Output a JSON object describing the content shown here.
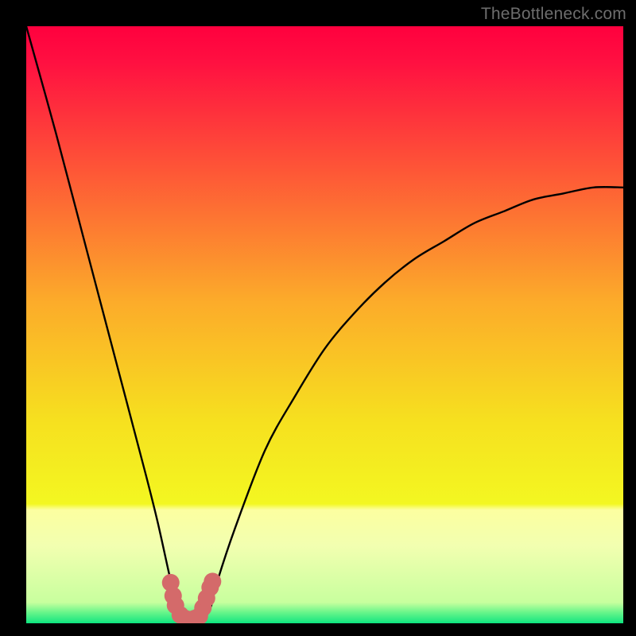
{
  "watermark": "TheBottleneck.com",
  "chart_data": {
    "type": "line",
    "title": "",
    "xlabel": "",
    "ylabel": "",
    "x_range": [
      0,
      100
    ],
    "y_range": [
      0,
      100
    ],
    "series": [
      {
        "name": "curve",
        "x": [
          0,
          5,
          10,
          15,
          20,
          22,
          24,
          25,
          26,
          27,
          28,
          29,
          30,
          31,
          32,
          35,
          40,
          45,
          50,
          55,
          60,
          65,
          70,
          75,
          80,
          85,
          90,
          95,
          100
        ],
        "y": [
          100,
          82,
          63,
          44,
          25,
          17,
          8,
          4,
          1,
          0,
          0,
          0,
          1,
          3,
          7,
          16,
          29,
          38,
          46,
          52,
          57,
          61,
          64,
          67,
          69,
          71,
          72,
          73,
          73
        ]
      }
    ],
    "markers": {
      "name": "highlight-points",
      "color": "#d46a6a",
      "x": [
        24.2,
        24.6,
        25.0,
        25.8,
        26.6,
        27.4,
        28.2,
        29.0,
        29.6,
        30.2,
        30.8,
        31.2
      ],
      "y": [
        6.8,
        4.6,
        3.0,
        1.4,
        0.8,
        0.6,
        0.8,
        1.2,
        2.6,
        4.2,
        6.0,
        7.0
      ]
    },
    "background_gradient": {
      "stops": [
        {
          "offset": 0.0,
          "color": "#ff003e"
        },
        {
          "offset": 0.06,
          "color": "#ff1041"
        },
        {
          "offset": 0.46,
          "color": "#fcab2a"
        },
        {
          "offset": 0.66,
          "color": "#f6e01f"
        },
        {
          "offset": 0.8,
          "color": "#f3f721"
        },
        {
          "offset": 0.81,
          "color": "#fcffa0"
        },
        {
          "offset": 0.87,
          "color": "#f2ffb0"
        },
        {
          "offset": 0.965,
          "color": "#c8ff9e"
        },
        {
          "offset": 0.982,
          "color": "#66f58a"
        },
        {
          "offset": 1.0,
          "color": "#12e580"
        }
      ]
    },
    "baseline": {
      "y": 0.0,
      "color": "#12e580"
    }
  }
}
